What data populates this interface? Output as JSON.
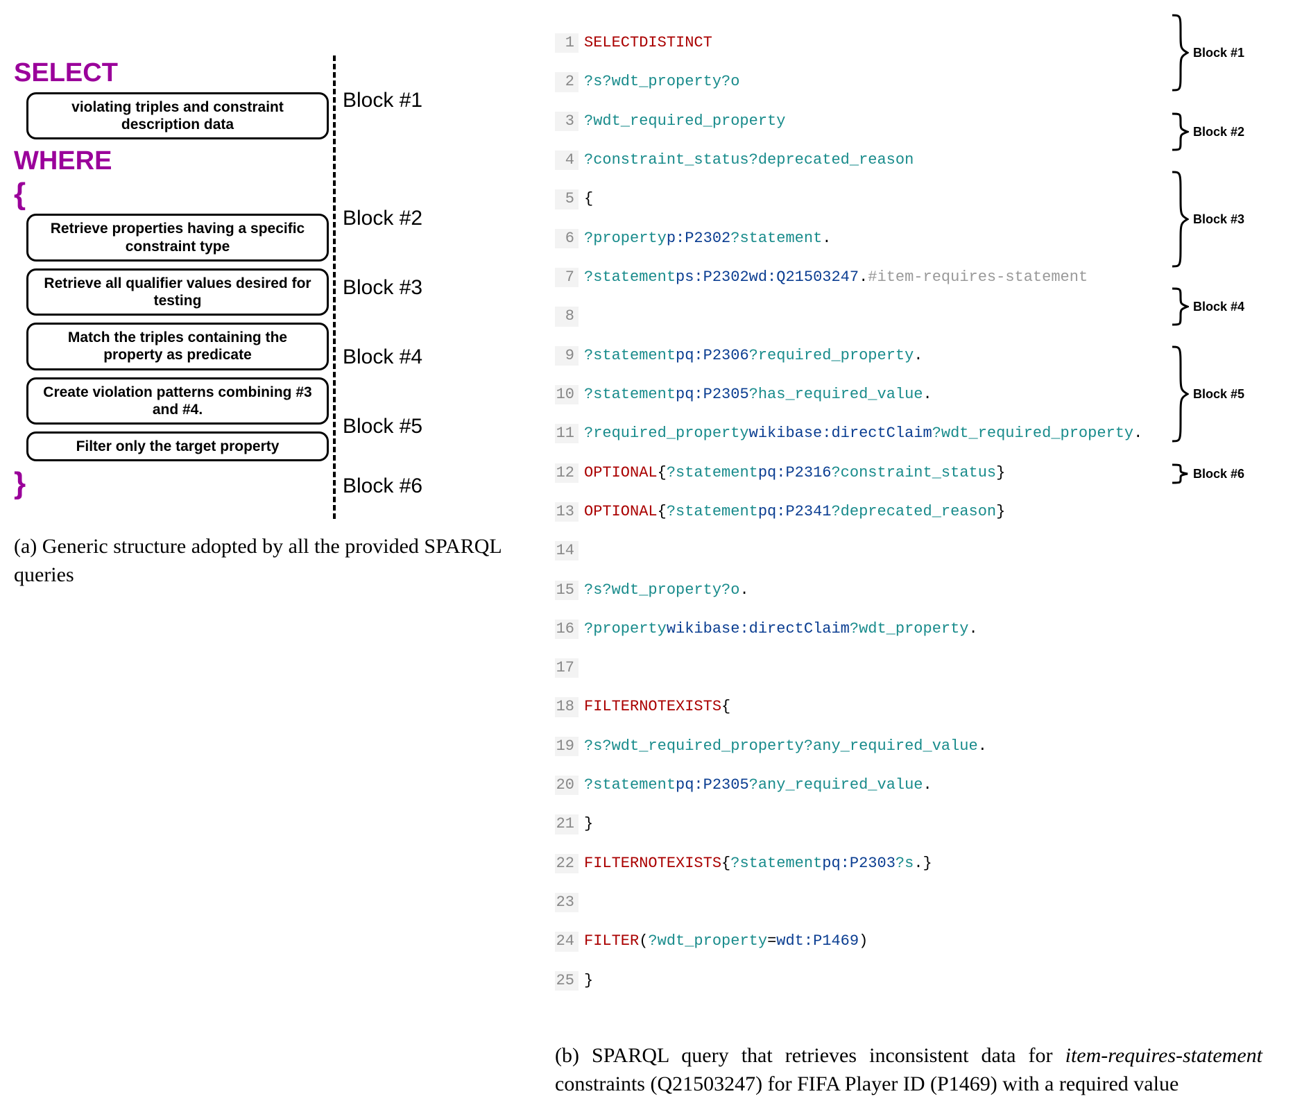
{
  "left": {
    "select": "SELECT",
    "where": "WHERE",
    "lbrace": "{",
    "rbrace": "}",
    "boxes": {
      "b1": "violating triples and constraint description data",
      "b2": "Retrieve properties having a specific constraint type",
      "b3": "Retrieve all qualifier values desired for testing",
      "b4": "Match the triples containing the property as predicate",
      "b5": "Create violation patterns combining #3 and #4.",
      "b6": "Filter only the target property"
    },
    "labels": {
      "l1": "Block #1",
      "l2": "Block #2",
      "l3": "Block #3",
      "l4": "Block #4",
      "l5": "Block #5",
      "l6": "Block #6"
    },
    "caption": "(a) Generic structure adopted by all the provided SPARQL queries"
  },
  "right": {
    "block_labels": {
      "b1": "Block #1",
      "b2": "Block #2",
      "b3": "Block #3",
      "b4": "Block #4",
      "b5": "Block #5",
      "b6": "Block #6"
    },
    "caption_pre": "(b) SPARQL query that retrieves inconsistent data for ",
    "caption_italic": "item-requires-statement",
    "caption_post": " constraints (Q21503247) for FIFA Player ID (P1469) with a required value"
  },
  "code": {
    "lines": [
      "1",
      "2",
      "3",
      "4",
      "5",
      "6",
      "7",
      "8",
      "9",
      "10",
      "11",
      "12",
      "13",
      "14",
      "15",
      "16",
      "17",
      "18",
      "19",
      "20",
      "21",
      "22",
      "23",
      "24",
      "25"
    ],
    "t": {
      "select": "SELECT",
      "distinct": "DISTINCT",
      "optional": "OPTIONAL",
      "filter": "FILTER",
      "not": "NOT",
      "exists": "EXISTS",
      "s": "?s",
      "o": "?o",
      "wdt_property": "?wdt_property",
      "wdt_required_property": "?wdt_required_property",
      "constraint_status": "?constraint_status",
      "deprecated_reason": "?deprecated_reason",
      "property": "?property",
      "statement": "?statement",
      "required_property": "?required_property",
      "has_required_value": "?has_required_value",
      "any_required_value": "?any_required_value",
      "p_P2302": "p:P2302",
      "ps_P2302": "ps:P2302",
      "wd_Q21503247": "wd:Q21503247",
      "pq_P2306": "pq:P2306",
      "pq_P2305": "pq:P2305",
      "pq_P2316": "pq:P2316",
      "pq_P2341": "pq:P2341",
      "pq_P2303": "pq:P2303",
      "directClaim": "wikibase:directClaim",
      "wdt_P1469": "wdt:P1469",
      "comment_irs": "#item-requires-statement",
      "lbrace": "{",
      "rbrace": "}",
      "dot": ".",
      "eq": "=",
      "lparen": "(",
      "rparen": ")"
    }
  }
}
